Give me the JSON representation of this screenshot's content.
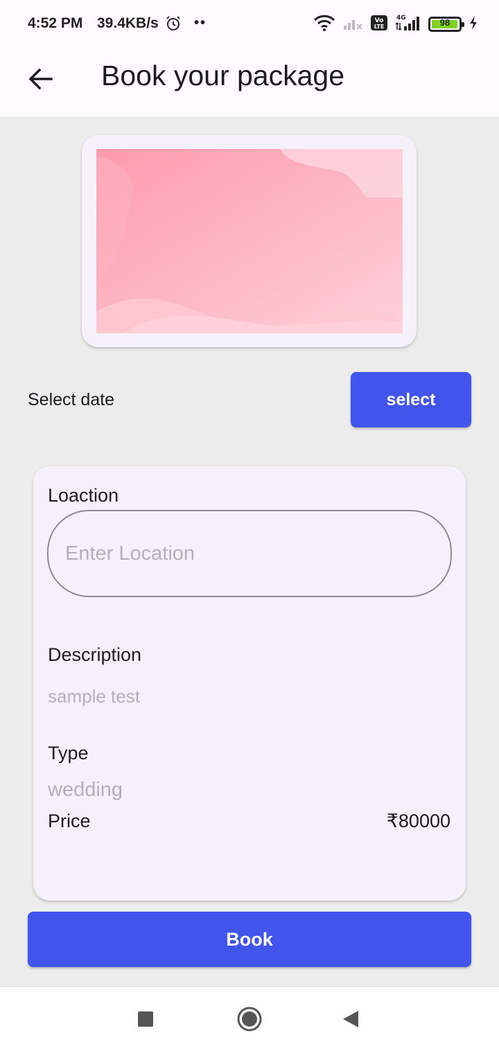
{
  "status_bar": {
    "time": "4:52 PM",
    "net_speed": "39.4KB/s",
    "dots": "••",
    "battery_level": "98",
    "battery_fraction": 0.98,
    "icons": [
      "alarm-icon",
      "wifi-icon",
      "signal-weak-icon",
      "volte-icon",
      "signal-4g-icon",
      "battery-icon",
      "charging-icon"
    ]
  },
  "app_bar": {
    "back_icon": "arrow-back-icon",
    "title": "Book your package"
  },
  "package_image": {
    "colors": [
      "#fd9bae",
      "#fdd0da"
    ]
  },
  "date_row": {
    "label": "Select date",
    "button_label": "select"
  },
  "details": {
    "location_label": "Loaction",
    "location_placeholder": "Enter Location",
    "location_value": "",
    "description_label": "Description",
    "description_value": "sample test",
    "type_label": "Type",
    "type_value": "wedding",
    "price_label": "Price",
    "price_value": "₹80000"
  },
  "book_button": {
    "label": "Book"
  },
  "nav_bar": {
    "icons": [
      "recents-square-icon",
      "home-circle-icon",
      "back-triangle-icon"
    ]
  },
  "colors": {
    "primary": "#4154ec",
    "background": "#ececec",
    "card": "#f4f1fa",
    "hint_text": "#b4b0b8"
  }
}
